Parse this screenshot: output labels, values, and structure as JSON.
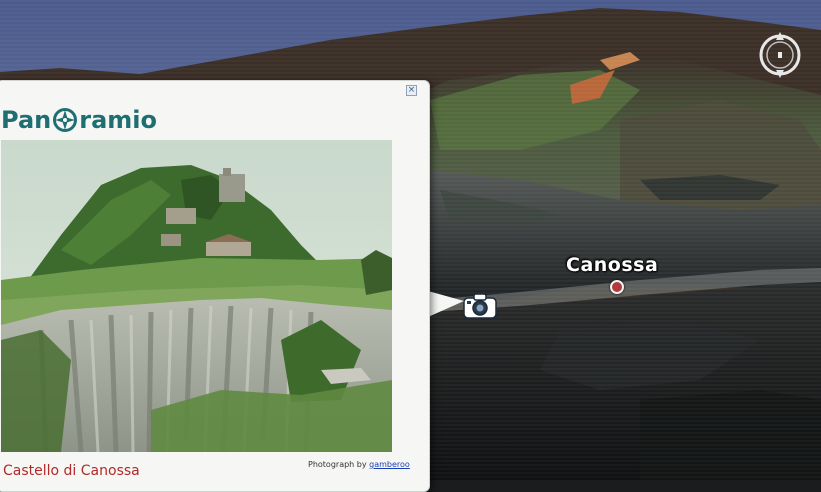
{
  "map": {
    "place_label": "Canossa"
  },
  "balloon": {
    "logo_prefix": "Pan",
    "logo_suffix": "ramio",
    "close_symbol": "×",
    "photo_title": "Castello di Canossa",
    "credit_prefix": "Photograph by",
    "credit_author": "gamberoo"
  },
  "icons": {
    "close": "close-icon",
    "logo_compass": "panoramio-logo-icon",
    "photo_marker": "camera-icon",
    "navigation": "compass-icon",
    "place_marker": "placemark-icon"
  },
  "colors": {
    "logo": "#1f6f72",
    "title": "#b02a2a",
    "link": "#1a3fb5",
    "placemark": "#b23a3a"
  }
}
